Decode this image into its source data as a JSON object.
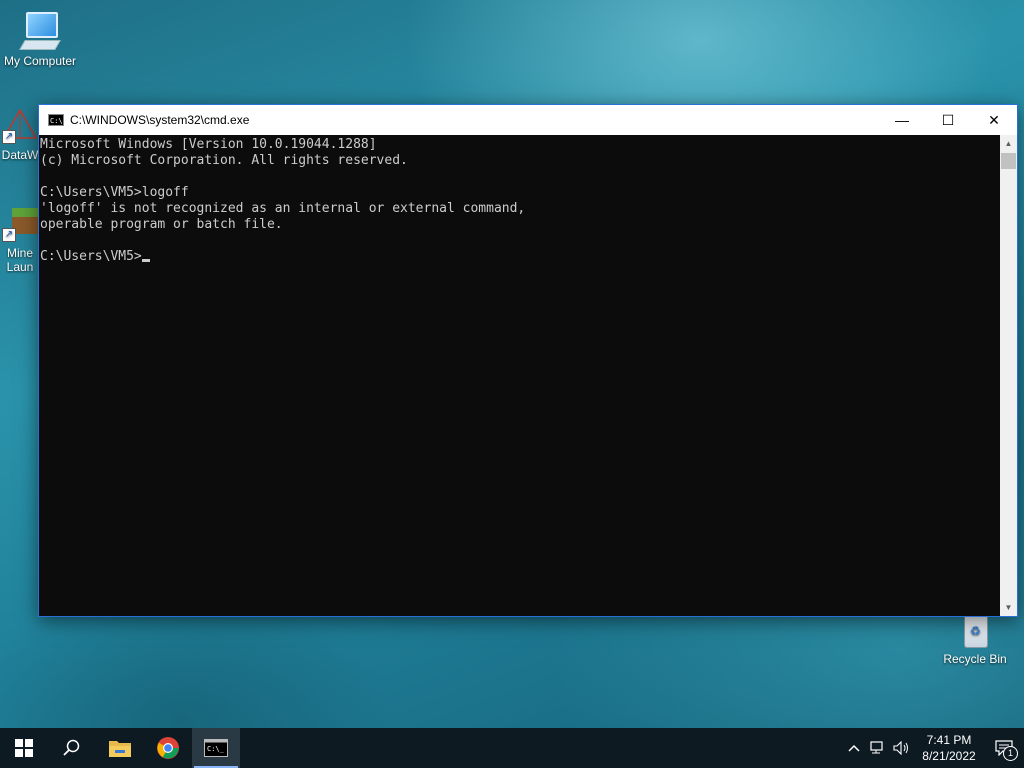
{
  "desktop": {
    "icons": [
      {
        "label": "My Computer"
      },
      {
        "label": "DataW"
      },
      {
        "label": "Mine"
      },
      {
        "label": "Laun"
      },
      {
        "label": "Recycle Bin"
      }
    ]
  },
  "window": {
    "title": "C:\\WINDOWS\\system32\\cmd.exe",
    "console_lines": [
      "Microsoft Windows [Version 10.0.19044.1288]",
      "(c) Microsoft Corporation. All rights reserved.",
      "",
      "C:\\Users\\VM5>logoff",
      "'logoff' is not recognized as an internal or external command,",
      "operable program or batch file.",
      "",
      "C:\\Users\\VM5>"
    ],
    "buttons": {
      "minimize": "—",
      "maximize": "☐",
      "close": "✕"
    }
  },
  "taskbar": {
    "clock_time": "7:41 PM",
    "clock_date": "8/21/2022",
    "notification_count": "1"
  },
  "colors": {
    "console_bg": "#0c0c0c",
    "console_fg": "#cccccc",
    "taskbar_bg": "#0e1a22",
    "window_border": "#2a6fd6"
  }
}
